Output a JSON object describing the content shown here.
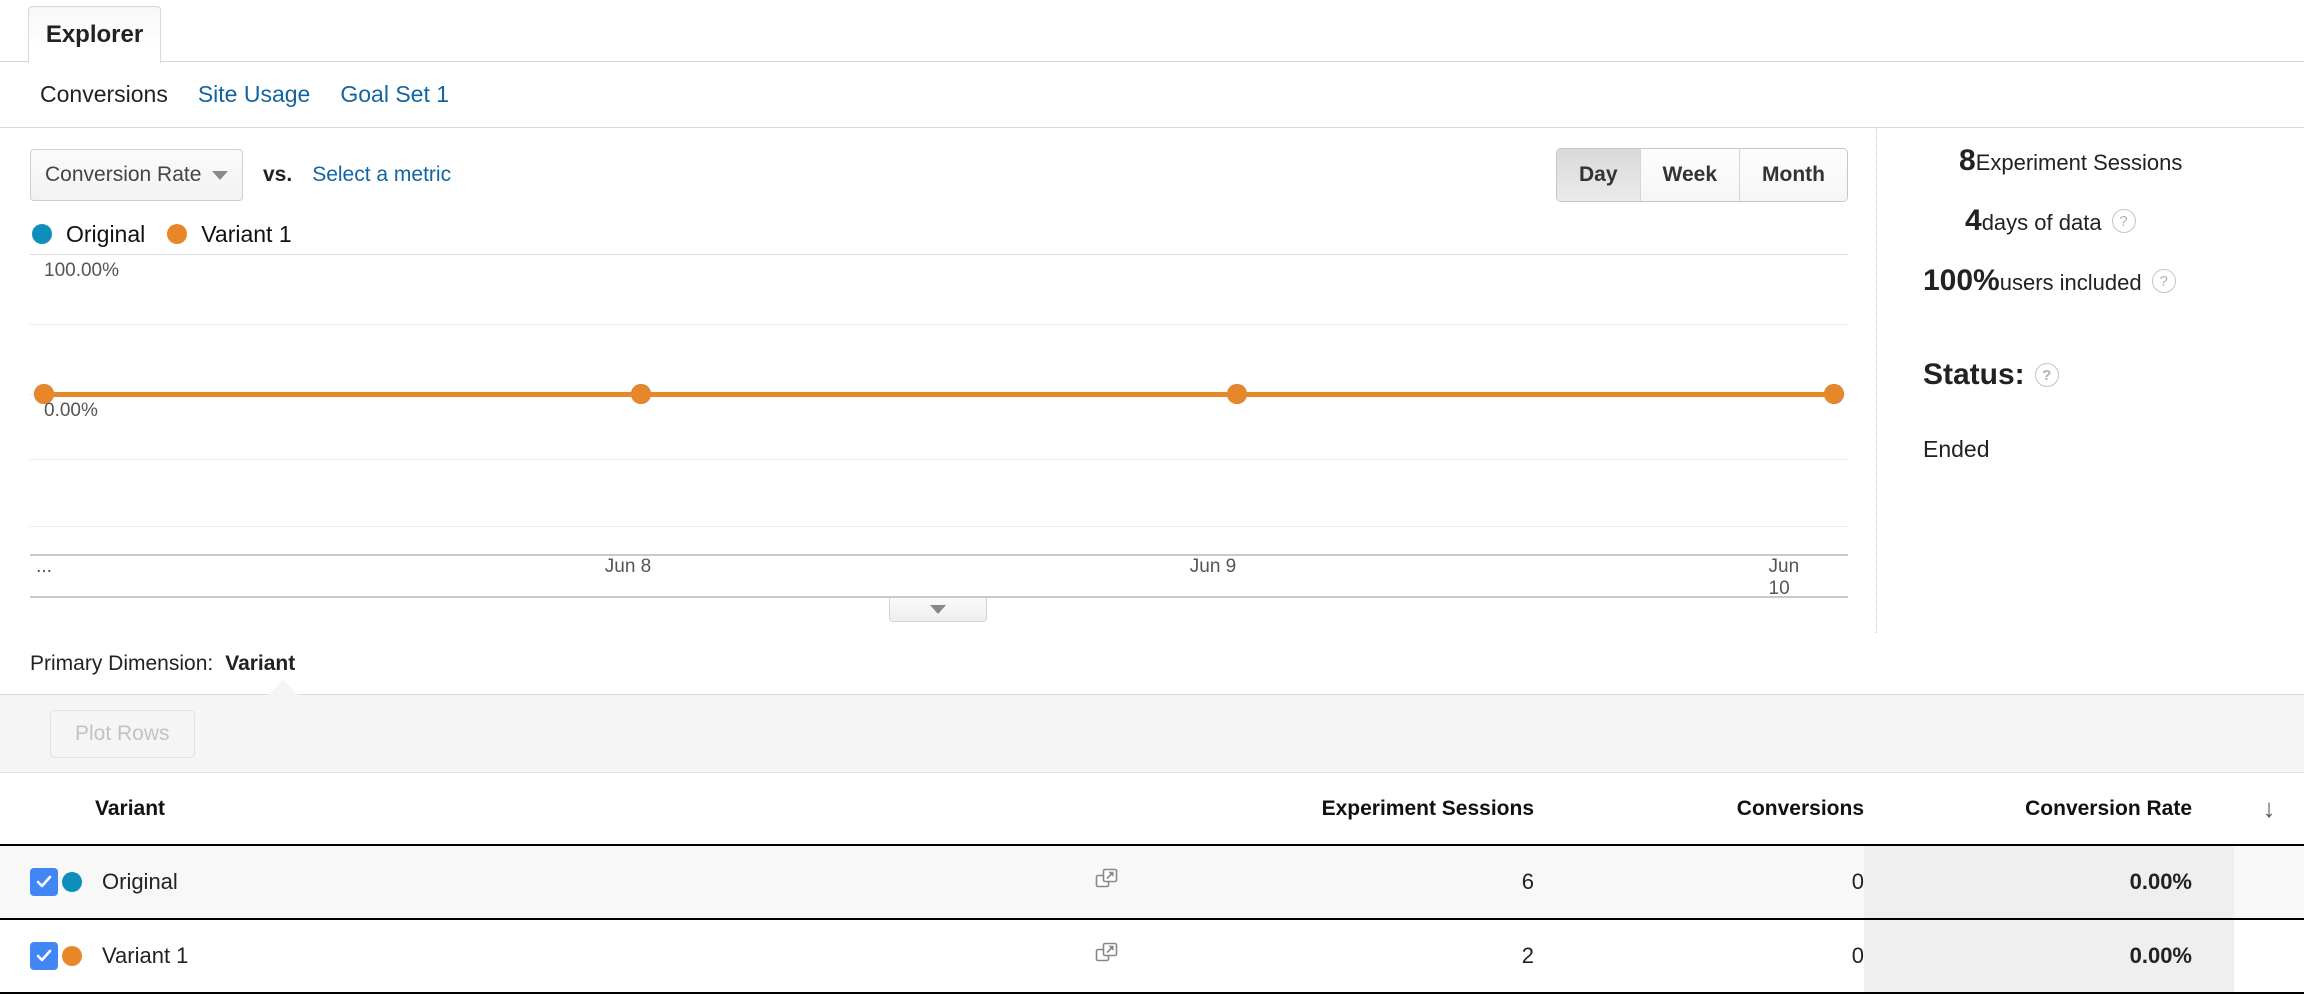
{
  "tab": {
    "label": "Explorer"
  },
  "subnav": [
    {
      "label": "Conversions",
      "active": true
    },
    {
      "label": "Site Usage",
      "active": false
    },
    {
      "label": "Goal Set 1",
      "active": false
    }
  ],
  "controls": {
    "metric_selected": "Conversion Rate",
    "vs_label": "vs.",
    "select_metric_label": "Select a metric",
    "granularity": [
      {
        "label": "Day",
        "active": true
      },
      {
        "label": "Week",
        "active": false
      },
      {
        "label": "Month",
        "active": false
      }
    ]
  },
  "legend": [
    {
      "label": "Original",
      "color": "#0d8ebd"
    },
    {
      "label": "Variant 1",
      "color": "#e8862a"
    }
  ],
  "summary": {
    "sessions_value": "8",
    "sessions_label": "Experiment Sessions",
    "days_value": "4",
    "days_label": "days of data",
    "users_value": "100%",
    "users_label": "users included",
    "status_label": "Status:",
    "status_value": "Ended",
    "help_glyph": "?"
  },
  "primary_dimension": {
    "label": "Primary Dimension:",
    "value": "Variant"
  },
  "toolbar": {
    "plot_rows_label": "Plot Rows"
  },
  "table": {
    "headers": {
      "variant": "Variant",
      "sessions": "Experiment Sessions",
      "conversions": "Conversions",
      "rate": "Conversion Rate",
      "sort_arrow": "↓"
    },
    "rows": [
      {
        "checked": true,
        "color": "#0d8ebd",
        "variant": "Original",
        "sessions": "6",
        "conversions": "0",
        "rate": "0.00%"
      },
      {
        "checked": true,
        "color": "#e8862a",
        "variant": "Variant 1",
        "sessions": "2",
        "conversions": "0",
        "rate": "0.00%"
      }
    ]
  },
  "chart_data": {
    "type": "line",
    "title": "Conversion Rate",
    "xlabel": "",
    "ylabel": "Conversion Rate",
    "x": [
      "...",
      "Jun 8",
      "Jun 9",
      "Jun 10"
    ],
    "xtick_labels": [
      "...",
      "Jun 8",
      "Jun 9",
      "Jun 10"
    ],
    "ytick_labels": [
      "100.00%",
      "0.00%"
    ],
    "ylim": [
      0,
      100
    ],
    "grid": true,
    "legend_position": "top-left",
    "series": [
      {
        "name": "Original",
        "color": "#0d8ebd",
        "values": [
          0,
          0,
          0,
          0
        ]
      },
      {
        "name": "Variant 1",
        "color": "#e8862a",
        "values": [
          0,
          0,
          0,
          0
        ]
      }
    ]
  }
}
